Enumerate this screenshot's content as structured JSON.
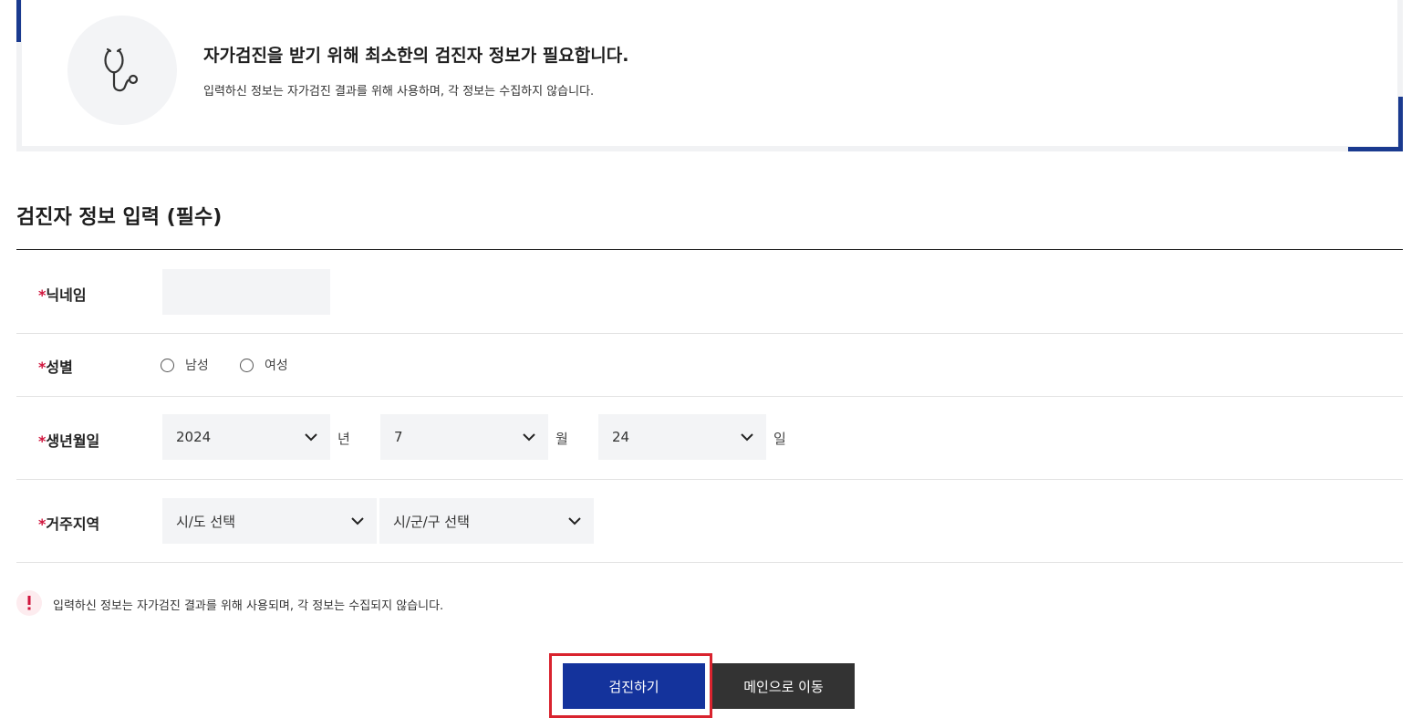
{
  "notice": {
    "icon": "stethoscope-icon",
    "title": "자가검진을 받기 위해 최소한의 검진자 정보가 필요합니다.",
    "subtitle": "입력하신 정보는 자가검진 결과를 위해 사용하며, 각 정보는 수집하지 않습니다."
  },
  "form": {
    "section_title": "검진자 정보 입력 (필수)",
    "required_mark": "*",
    "nickname": {
      "label": "닉네임",
      "value": ""
    },
    "gender": {
      "label": "성별",
      "options": [
        "남성",
        "여성"
      ]
    },
    "birth": {
      "label": "생년월일",
      "year": "2024",
      "year_unit": "년",
      "month": "7",
      "month_unit": "월",
      "day": "24",
      "day_unit": "일"
    },
    "region": {
      "label": "거주지역",
      "province_placeholder": "시/도 선택",
      "city_placeholder": "시/군/구 선택"
    }
  },
  "info": {
    "icon": "exclamation-icon",
    "text": "입력하신 정보는 자가검진 결과를 위해 사용되며, 각 정보는 수집되지 않습니다."
  },
  "buttons": {
    "submit": "검진하기",
    "main": "메인으로 이동"
  },
  "colors": {
    "accent_navy": "#14339c",
    "required_red": "#d0143c",
    "highlight_red": "#d9232e",
    "dark_button": "#333333"
  }
}
